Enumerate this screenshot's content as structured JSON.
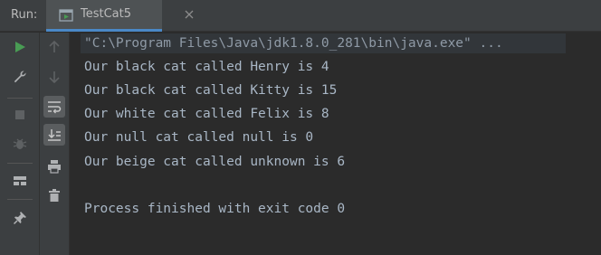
{
  "run_panel": {
    "label": "Run:",
    "tab": {
      "title": "TestCat5",
      "icon": "run-config-icon"
    }
  },
  "toolbar_left": [
    {
      "name": "rerun",
      "icon": "play-icon",
      "color": "#499c54"
    },
    {
      "name": "modify-config",
      "icon": "wrench-icon"
    },
    {
      "name": "stop",
      "icon": "stop-icon"
    },
    {
      "name": "restart-debug",
      "icon": "bug-icon"
    },
    {
      "name": "layout",
      "icon": "layout-icon"
    },
    {
      "name": "pin",
      "icon": "pin-icon"
    }
  ],
  "toolbar_right": [
    {
      "name": "up",
      "icon": "arrow-up-icon"
    },
    {
      "name": "down",
      "icon": "arrow-down-icon"
    },
    {
      "name": "soft-wrap",
      "icon": "soft-wrap-icon"
    },
    {
      "name": "scroll-to-end",
      "icon": "scroll-to-end-icon"
    },
    {
      "name": "print",
      "icon": "print-icon"
    },
    {
      "name": "clear",
      "icon": "trash-icon"
    }
  ],
  "console": {
    "command": "\"C:\\Program Files\\Java\\jdk1.8.0_281\\bin\\java.exe\" ...",
    "output": [
      "Our black cat called Henry is 4",
      "Our black cat called Kitty is 15",
      "Our white cat called Felix is 8",
      "Our null cat called null is 0",
      "Our beige cat called unknown is 6"
    ],
    "exit_message": "Process finished with exit code 0"
  },
  "colors": {
    "background": "#2b2b2b",
    "panel": "#3c3f41",
    "text": "#a9b7c6",
    "accent": "#4a88c7",
    "run_green": "#499c54"
  }
}
